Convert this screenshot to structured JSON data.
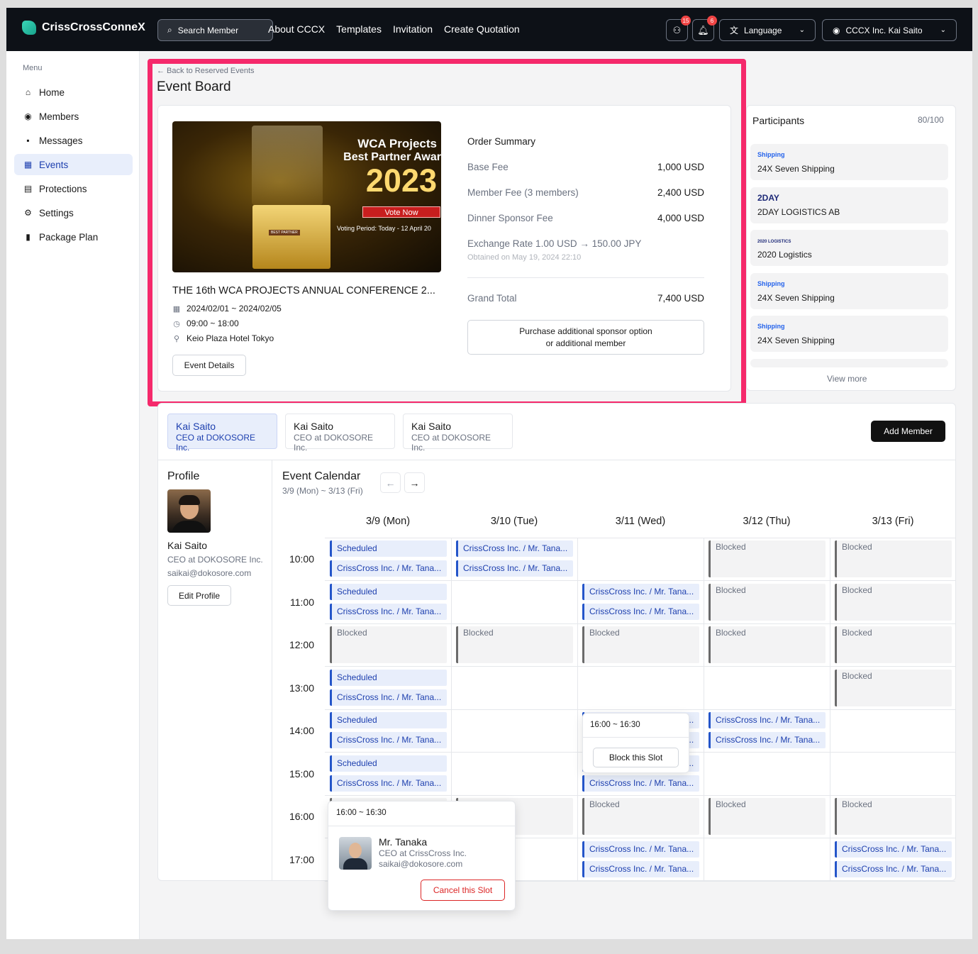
{
  "topbar": {
    "brand": "CrissCrossConneX",
    "search_label": "Search Member",
    "nav": [
      "About CCCX",
      "Templates",
      "Invitation",
      "Create Quotation"
    ],
    "messages_badge": "15",
    "notifications_badge": "6",
    "language_label": "Language",
    "account_label": "CCCX Inc. Kai Saito"
  },
  "sidebar": {
    "heading": "Menu",
    "items": [
      {
        "label": "Home",
        "icon": "home-icon"
      },
      {
        "label": "Members",
        "icon": "members-icon"
      },
      {
        "label": "Messages",
        "icon": "messages-icon"
      },
      {
        "label": "Events",
        "icon": "events-icon",
        "active": true
      },
      {
        "label": "Protections",
        "icon": "protections-icon"
      },
      {
        "label": "Settings",
        "icon": "settings-icon"
      },
      {
        "label": "Package Plan",
        "icon": "package-icon"
      }
    ]
  },
  "event": {
    "back_link": "← Back to Reserved Events",
    "page_title": "Event Board",
    "banner": {
      "line1": "WCA Projects",
      "line2": "Best Partner Awar",
      "year": "2023",
      "vote": "Vote Now",
      "period": "Voting Period: Today - 12 April 20",
      "badge": "BEST PARTNER"
    },
    "title": "THE 16th WCA PROJECTS ANNUAL CONFERENCE 2...",
    "dates": "2024/02/01 ~ 2024/02/05",
    "time": "09:00 ~ 18:00",
    "venue": "Keio Plaza Hotel Tokyo",
    "details_button": "Event Details"
  },
  "order": {
    "heading": "Order Summary",
    "rows": [
      {
        "label": "Base Fee",
        "value": "1,000 USD"
      },
      {
        "label": "Member Fee (3 members)",
        "value": "2,400 USD"
      },
      {
        "label": "Dinner Sponsor Fee",
        "value": "4,000 USD"
      },
      {
        "label": "Exchange Rate 1.00 USD → 150.00 JPY",
        "value": ""
      }
    ],
    "obtained": "Obtained on May 19, 2024 22:10",
    "grand_total_label": "Grand Total",
    "grand_total_value": "7,400 USD",
    "purchase_line1": "Purchase additional sponsor option",
    "purchase_line2": "or additional member"
  },
  "participants": {
    "heading": "Participants",
    "count": "80/100",
    "items": [
      {
        "logo": "Shipping",
        "name": "24X Seven Shipping"
      },
      {
        "logo": "2DAY",
        "name": "2DAY LOGISTICS AB"
      },
      {
        "logo": "2020 LOGISTICS",
        "name": "2020 Logistics"
      },
      {
        "logo": "Shipping",
        "name": "24X Seven Shipping"
      },
      {
        "logo": "Shipping",
        "name": "24X Seven Shipping"
      }
    ],
    "view_more": "View more"
  },
  "members": {
    "tabs": [
      {
        "name": "Kai Saito",
        "role": "CEO at DOKOSORE Inc.",
        "active": true
      },
      {
        "name": "Kai Saito",
        "role": "CEO at DOKOSORE Inc."
      },
      {
        "name": "Kai Saito",
        "role": "CEO at DOKOSORE Inc."
      }
    ],
    "add_button": "Add Member"
  },
  "profile": {
    "heading": "Profile",
    "name": "Kai Saito",
    "role": "CEO at DOKOSORE Inc.",
    "email": "saikai@dokosore.com",
    "edit_button": "Edit Profile"
  },
  "calendar": {
    "heading": "Event Calendar",
    "range": "3/9 (Mon) ~ 3/13 (Fri)",
    "days": [
      "3/9 (Mon)",
      "3/10 (Tue)",
      "3/11 (Wed)",
      "3/12 (Thu)",
      "3/13 (Fri)"
    ],
    "times": [
      "10:00",
      "11:00",
      "12:00",
      "13:00",
      "14:00",
      "15:00",
      "16:00",
      "17:00"
    ],
    "scheduled": "Scheduled",
    "booking": "CrissCross Inc. / Mr. Tana...",
    "booking_short": "CrissCross Inc. / Mr. Tana...",
    "blocked": "Blocked",
    "cells": [
      [
        "sb",
        "bb",
        "",
        "k",
        "k"
      ],
      [
        "sb",
        "",
        "bb",
        "k",
        "k"
      ],
      [
        "k",
        "k",
        "k",
        "k",
        "k"
      ],
      [
        "sb",
        "",
        "",
        "",
        "k"
      ],
      [
        "sb",
        "",
        "bb",
        "bb",
        ""
      ],
      [
        "sb",
        "",
        "bb",
        "",
        ""
      ],
      [
        "k",
        "k",
        "k",
        "k",
        "k"
      ],
      [
        "",
        "",
        "bb",
        "",
        "bb"
      ]
    ],
    "block_popup": {
      "time": "16:00 ~ 16:30",
      "button": "Block this Slot"
    },
    "detail_popup": {
      "time": "16:00 ~ 16:30",
      "name": "Mr. Tanaka",
      "role": "CEO at CrissCross Inc.",
      "email": "saikai@dokosore.com",
      "cancel": "Cancel this Slot"
    }
  }
}
